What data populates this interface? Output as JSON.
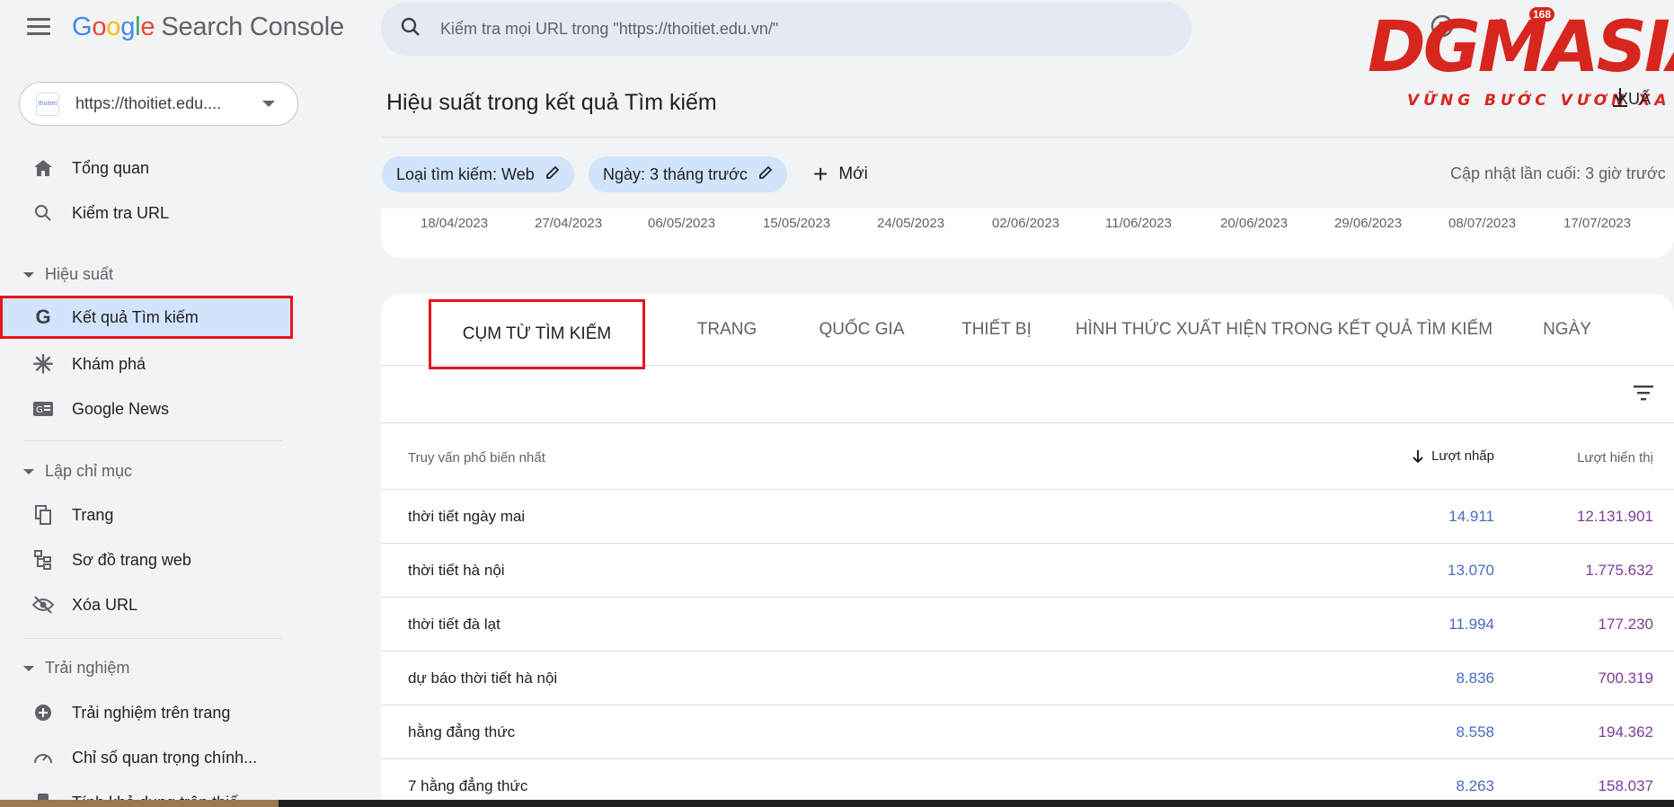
{
  "app": {
    "logo_google": [
      "G",
      "o",
      "o",
      "g",
      "l",
      "e"
    ],
    "logo_rest": "Search Console"
  },
  "property": {
    "url": "https://thoitiet.edu....",
    "favicon": "thoitiet"
  },
  "search": {
    "placeholder": "Kiểm tra mọi URL trong \"https://thoitiet.edu.vn/\""
  },
  "sidebar": {
    "overview": "Tổng quan",
    "url_inspect": "Kiểm tra URL",
    "section_performance": "Hiệu suất",
    "search_results": "Kết quả Tìm kiếm",
    "discover": "Khám phá",
    "google_news": "Google News",
    "section_indexing": "Lập chỉ mục",
    "pages": "Trang",
    "sitemaps": "Sơ đồ trang web",
    "removals": "Xóa URL",
    "section_experience": "Trải nghiệm",
    "page_experience": "Trải nghiệm trên trang",
    "core_web_vitals": "Chỉ số quan trọng chính...",
    "mobile_usability": "Tính khả dụng trên thiế..."
  },
  "watermark": {
    "brand": "DGMASIA",
    "tagline": "VỮNG BƯỚC VƯƠN XA",
    "badge": "168"
  },
  "header": {
    "title": "Hiệu suất trong kết quả Tìm kiếm",
    "export": "XUẤ",
    "chip_search_type": "Loại tìm kiếm: Web",
    "chip_date": "Ngày: 3 tháng trước",
    "new_button": "Mới",
    "last_updated": "Cập nhật lần cuối: 3 giờ trước"
  },
  "chart_axis": {
    "dates": [
      "18/04/2023",
      "27/04/2023",
      "06/05/2023",
      "15/05/2023",
      "24/05/2023",
      "02/06/2023",
      "11/06/2023",
      "20/06/2023",
      "29/06/2023",
      "08/07/2023",
      "17/07/2023"
    ]
  },
  "tabs": [
    "CỤM TỪ TÌM KIẾM",
    "TRANG",
    "QUỐC GIA",
    "THIẾT BỊ",
    "HÌNH THỨC XUẤT HIỆN TRONG KẾT QUẢ TÌM KIẾM",
    "NGÀY"
  ],
  "table": {
    "col_query": "Truy vấn phổ biến nhất",
    "col_clicks": "Lượt nhấp",
    "col_impressions": "Lượt hiển thị",
    "rows": [
      {
        "query": "thời tiết ngày mai",
        "clicks": "14.911",
        "impressions": "12.131.901"
      },
      {
        "query": "thời tiết hà nội",
        "clicks": "13.070",
        "impressions": "1.775.632"
      },
      {
        "query": "thời tiết đà lạt",
        "clicks": "11.994",
        "impressions": "177.230"
      },
      {
        "query": "dự báo thời tiết hà nội",
        "clicks": "8.836",
        "impressions": "700.319"
      },
      {
        "query": "hằng đẳng thức",
        "clicks": "8.558",
        "impressions": "194.362"
      },
      {
        "query": "7 hằng đẳng thức",
        "clicks": "8.263",
        "impressions": "158.037"
      }
    ]
  },
  "colors": {
    "accent_blue": "#4a6ac2",
    "impr_purple": "#7b3d9c",
    "highlight_red": "#e8141c",
    "chip_bg": "#d2e3fc"
  }
}
